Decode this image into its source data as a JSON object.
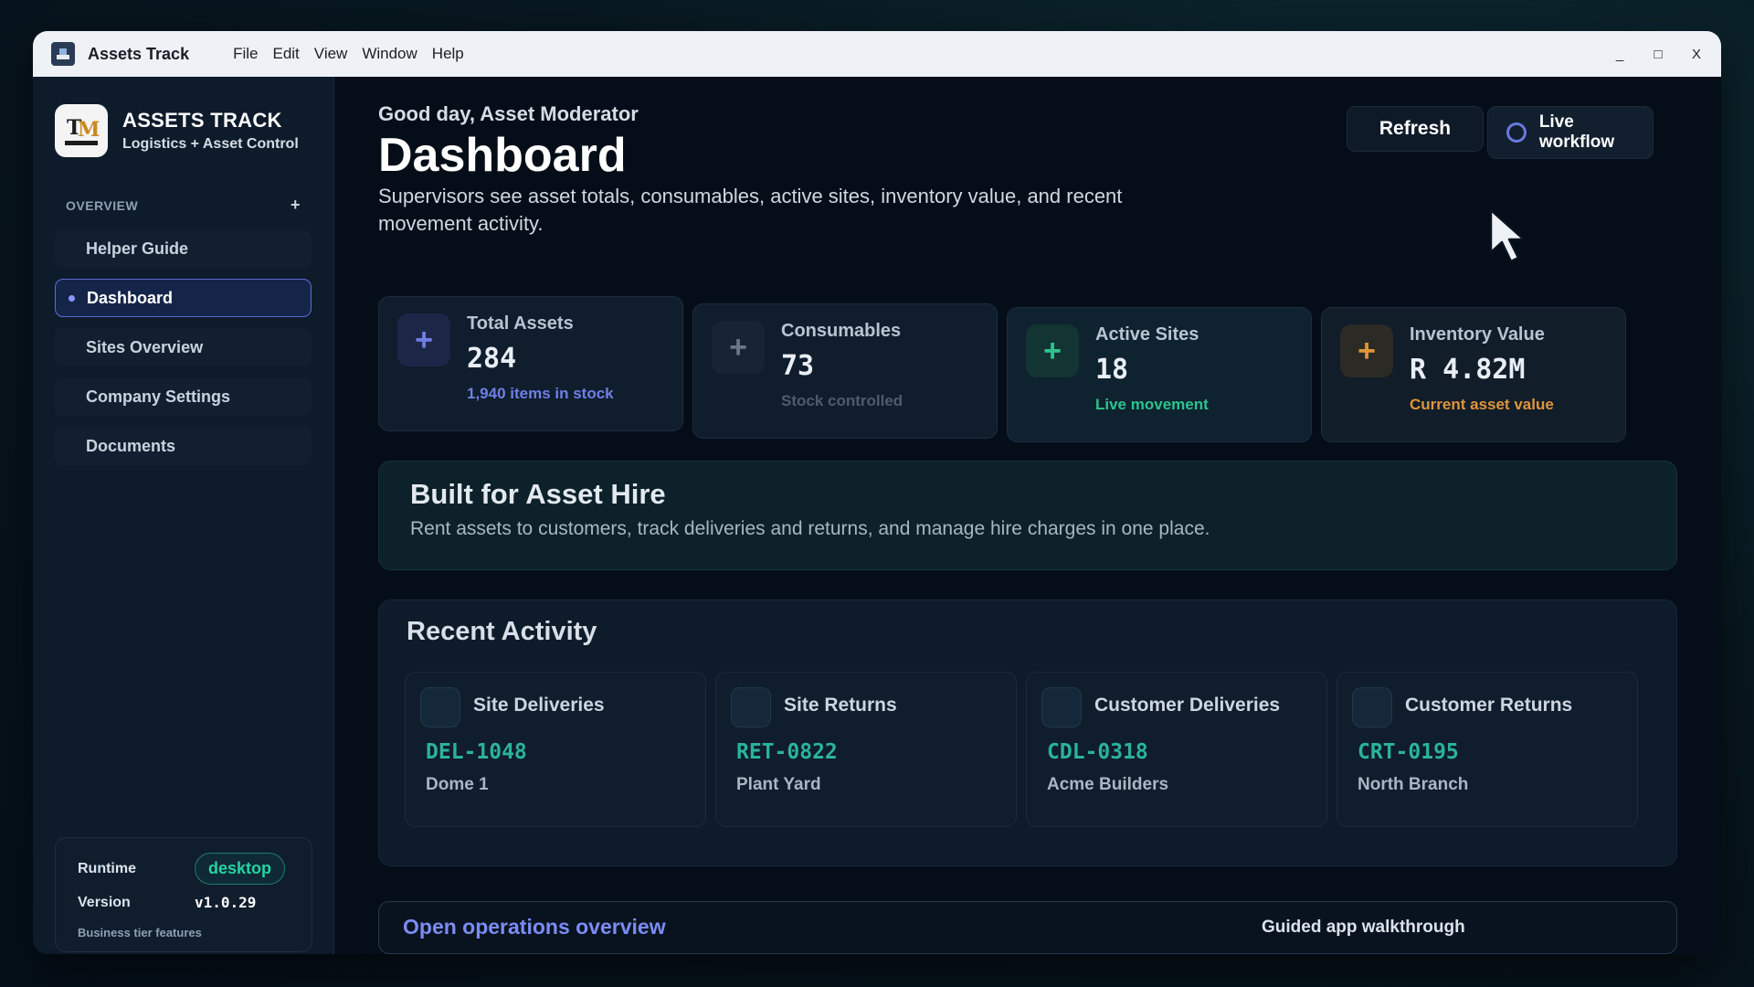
{
  "titlebar": {
    "app_title": "Assets Track",
    "menu": [
      "File",
      "Edit",
      "View",
      "Window",
      "Help"
    ],
    "controls": {
      "minimize": "_",
      "maximize": "□",
      "close": "X"
    }
  },
  "sidebar": {
    "brand_name": "ASSETS TRACK",
    "brand_sub": "Logistics + Asset Control",
    "section_label": "OVERVIEW",
    "section_add": "+",
    "items": [
      {
        "label": "Helper Guide",
        "active": false
      },
      {
        "label": "Dashboard",
        "active": true
      },
      {
        "label": "Sites Overview",
        "active": false
      },
      {
        "label": "Company Settings",
        "active": false
      },
      {
        "label": "Documents",
        "active": false
      }
    ],
    "runtime": {
      "runtime_label": "Runtime",
      "runtime_value": "desktop",
      "version_label": "Version",
      "version_value": "v1.0.29",
      "footer": "Business tier features"
    }
  },
  "main": {
    "greeting": "Good day, Asset Moderator",
    "title": "Dashboard",
    "description": "Supervisors see asset totals, consumables, active sites, inventory value, and recent movement activity.",
    "refresh_label": "Refresh",
    "live_label": "Live workflow",
    "stats": [
      {
        "label": "Total Assets",
        "value": "284",
        "sub": "1,940 items in stock",
        "accent": "#6f7fe6",
        "icon": "plus-icon"
      },
      {
        "label": "Consumables",
        "value": "73",
        "sub": "Stock controlled",
        "accent": "#6a7686",
        "icon": "plus-icon"
      },
      {
        "label": "Active Sites",
        "value": "18",
        "sub": "Live movement",
        "accent": "#2bc48e",
        "icon": "plus-icon"
      },
      {
        "label": "Inventory Value",
        "value": "R 4.82M",
        "sub": "Current asset value",
        "accent": "#e0953a",
        "icon": "plus-icon"
      }
    ],
    "banner": {
      "title": "Built for Asset Hire",
      "text": "Rent assets to customers, track deliveries and returns, and manage hire charges in one place."
    },
    "activity": {
      "title": "Recent Activity",
      "cards": [
        {
          "title": "Site Deliveries",
          "code": "DEL-1048",
          "place": "Dome 1"
        },
        {
          "title": "Site Returns",
          "code": "RET-0822",
          "place": "Plant Yard"
        },
        {
          "title": "Customer Deliveries",
          "code": "CDL-0318",
          "place": "Acme Builders"
        },
        {
          "title": "Customer Returns",
          "code": "CRT-0195",
          "place": "North Branch"
        }
      ]
    },
    "bottom": {
      "open_ops": "Open operations overview",
      "walkthrough": "Guided app walkthrough"
    }
  }
}
